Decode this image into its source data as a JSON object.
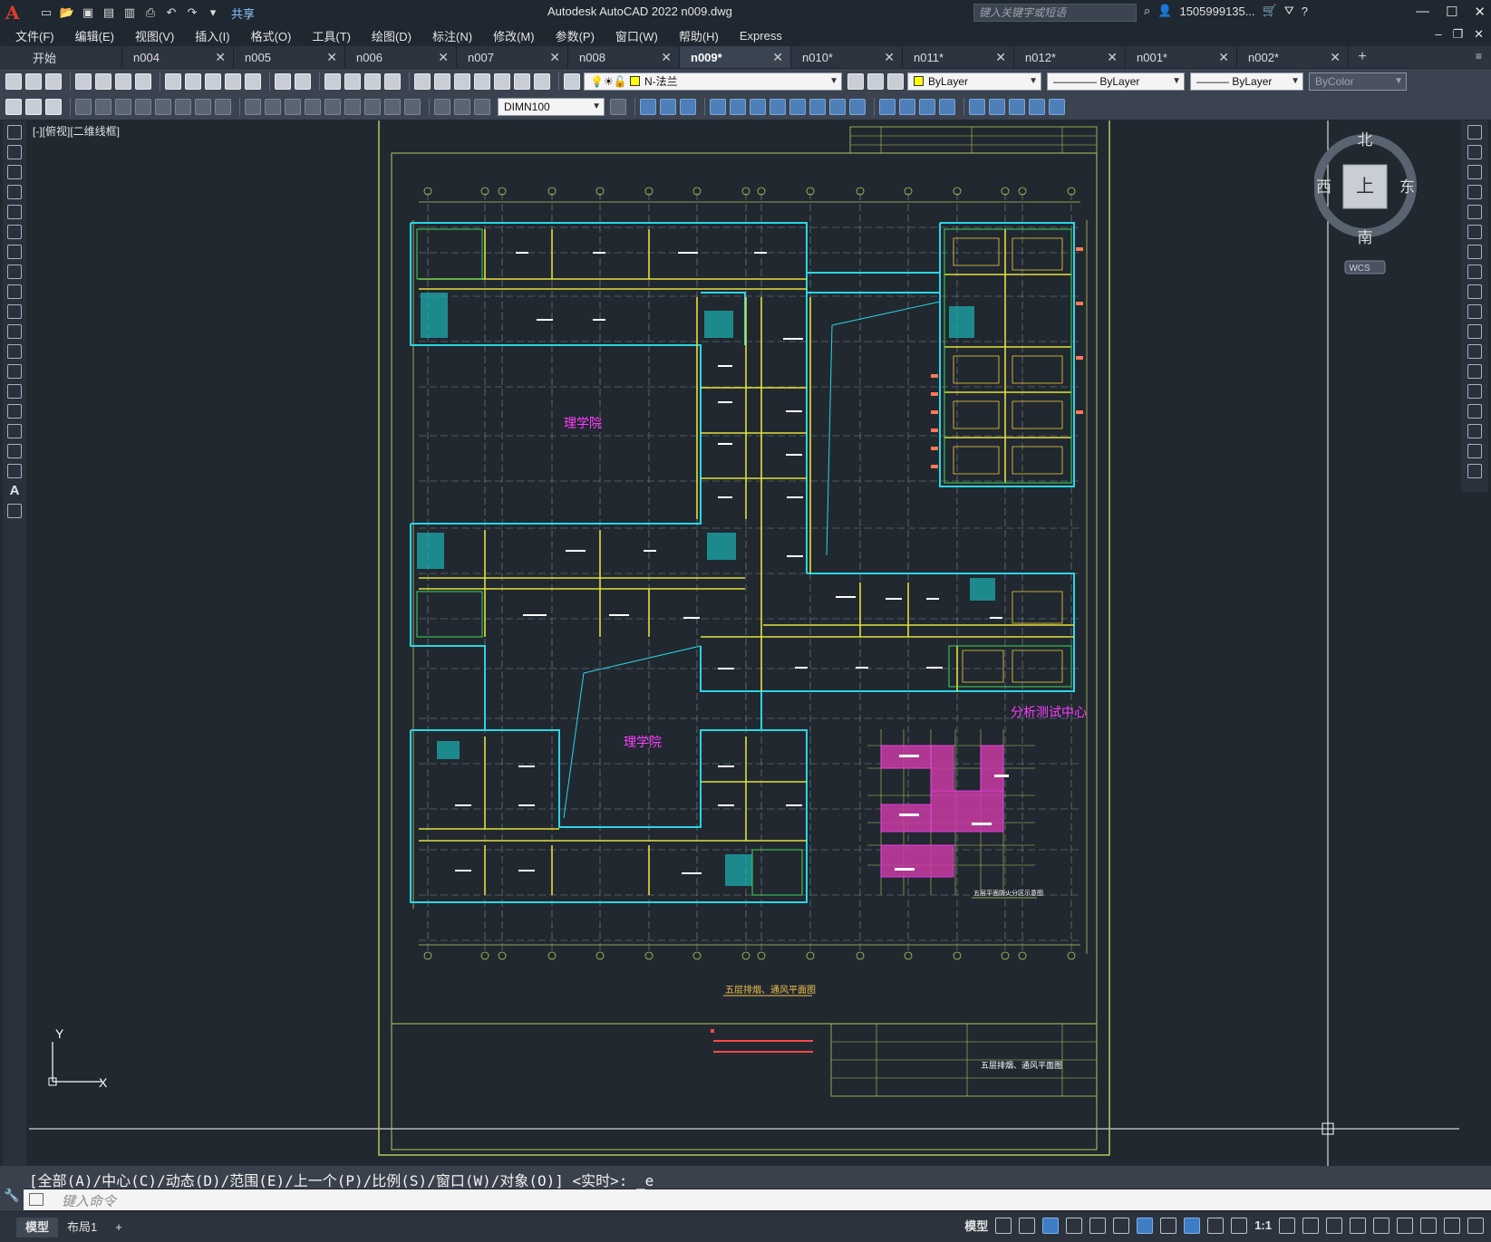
{
  "app": {
    "title": "Autodesk AutoCAD 2022    n009.dwg",
    "logo": "A",
    "share": "共享",
    "search_placeholder": "键入关键字或短语",
    "user": "1505999135...",
    "search_icon": "search-icon"
  },
  "menu": [
    "文件(F)",
    "编辑(E)",
    "视图(V)",
    "插入(I)",
    "格式(O)",
    "工具(T)",
    "绘图(D)",
    "标注(N)",
    "修改(M)",
    "参数(P)",
    "窗口(W)",
    "帮助(H)",
    "Express"
  ],
  "tabs": [
    {
      "label": "开始",
      "closable": false,
      "active": false
    },
    {
      "label": "n004",
      "closable": true,
      "active": false
    },
    {
      "label": "n005",
      "closable": true,
      "active": false
    },
    {
      "label": "n006",
      "closable": true,
      "active": false
    },
    {
      "label": "n007",
      "closable": true,
      "active": false
    },
    {
      "label": "n008",
      "closable": true,
      "active": false
    },
    {
      "label": "n009*",
      "closable": true,
      "active": true
    },
    {
      "label": "n010*",
      "closable": true,
      "active": false
    },
    {
      "label": "n011*",
      "closable": true,
      "active": false
    },
    {
      "label": "n012*",
      "closable": true,
      "active": false
    },
    {
      "label": "n001*",
      "closable": true,
      "active": false
    },
    {
      "label": "n002*",
      "closable": true,
      "active": false
    }
  ],
  "toolbar": {
    "layer": "N-法兰",
    "color": "ByLayer",
    "linetype": "ByLayer",
    "lineweight": "ByLayer",
    "plotstyle": "ByColor",
    "dimstyle": "DIMN100"
  },
  "viewport": {
    "label": "[-][俯视][二维线框]",
    "compass": {
      "north": "北",
      "south": "南",
      "east": "东",
      "west": "西",
      "top": "上",
      "wcs": "WCS"
    },
    "ucs": {
      "x": "X",
      "y": "Y"
    }
  },
  "drawing": {
    "label_west_top": "理学院",
    "label_west_bottom": "理学院",
    "label_east": "分析测试中心",
    "plan_title": "五层排烟、通风平面图",
    "key_plan_title": "五层平面防火分区示意图",
    "titleblock_name": "五层排烟、通风平面图"
  },
  "command": {
    "history": "[全部(A)/中心(C)/动态(D)/范围(E)/上一个(P)/比例(S)/窗口(W)/对象(O)] <实时>: _e",
    "placeholder": "键入命令"
  },
  "status": {
    "model_tab": "模型",
    "layout_tab": "布局1",
    "model_label": "模型",
    "scale": "1:1"
  }
}
